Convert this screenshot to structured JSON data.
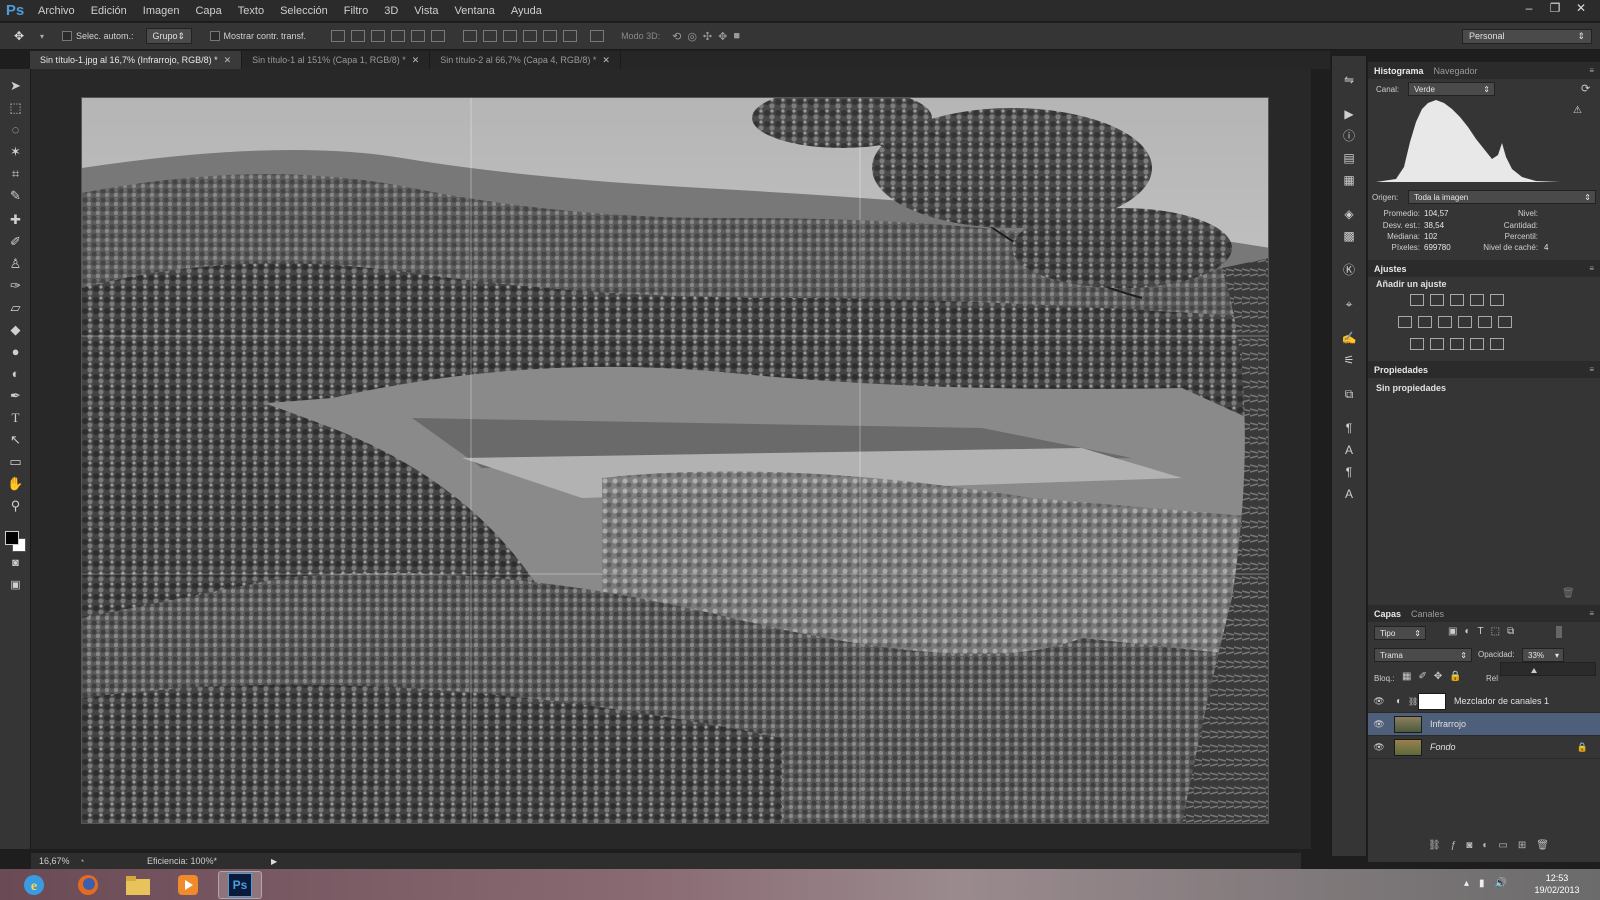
{
  "app": {
    "logo": "Ps"
  },
  "menu": [
    "Archivo",
    "Edición",
    "Imagen",
    "Capa",
    "Texto",
    "Selección",
    "Filtro",
    "3D",
    "Vista",
    "Ventana",
    "Ayuda"
  ],
  "window_controls": {
    "minimize": "–",
    "restore": "❐",
    "close": "✕"
  },
  "options": {
    "auto_select_label": "Selec. autom.:",
    "auto_select_value": "Grupo",
    "show_transform_label": "Mostrar contr. transf.",
    "mode_3d_label": "Modo 3D:",
    "workspace": "Personal"
  },
  "tabs": [
    {
      "label": "Sin título-1.jpg al 16,7% (Infrarrojo, RGB/8) *",
      "active": true
    },
    {
      "label": "Sin título-1 al 151% (Capa 1, RGB/8) *",
      "active": false
    },
    {
      "label": "Sin título-2 al 66,7% (Capa 4, RGB/8) *",
      "active": false
    }
  ],
  "status": {
    "zoom": "16,67%",
    "efficiency": "Eficiencia: 100%*"
  },
  "histogram": {
    "tabs": [
      "Histograma",
      "Navegador"
    ],
    "channel_label": "Canal:",
    "channel_value": "Verde",
    "source_label": "Origen:",
    "source_value": "Toda la imagen",
    "stats_left": [
      {
        "label": "Promedio:",
        "value": "104,57"
      },
      {
        "label": "Desv. est.:",
        "value": "38,54"
      },
      {
        "label": "Mediana:",
        "value": "102"
      },
      {
        "label": "Píxeles:",
        "value": "699780"
      }
    ],
    "stats_right": [
      {
        "label": "Nivel:",
        "value": ""
      },
      {
        "label": "Cantidad:",
        "value": ""
      },
      {
        "label": "Percentil:",
        "value": ""
      },
      {
        "label": "Nivel de caché:",
        "value": "4"
      }
    ]
  },
  "adjustments": {
    "tab": "Ajustes",
    "add_label": "Añadir un ajuste"
  },
  "properties": {
    "tab": "Propiedades",
    "empty_label": "Sin propiedades"
  },
  "layers": {
    "tabs": [
      "Capas",
      "Canales"
    ],
    "filter_label": "Tipo",
    "blend_mode": "Trama",
    "opacity_label": "Opacidad:",
    "opacity_value": "33%",
    "lock_label": "Bloq.:",
    "fill_label": "Rel",
    "items": [
      {
        "name": "Mezclador de canales 1",
        "selected": false
      },
      {
        "name": "Infrarrojo",
        "selected": true
      },
      {
        "name": "Fondo",
        "selected": false
      }
    ]
  },
  "taskbar": {
    "apps": [
      "internet-explorer",
      "firefox",
      "file-explorer",
      "media-player",
      "photoshop"
    ],
    "photoshop_label": "Ps",
    "time": "12:53",
    "date": "19/02/2013"
  }
}
